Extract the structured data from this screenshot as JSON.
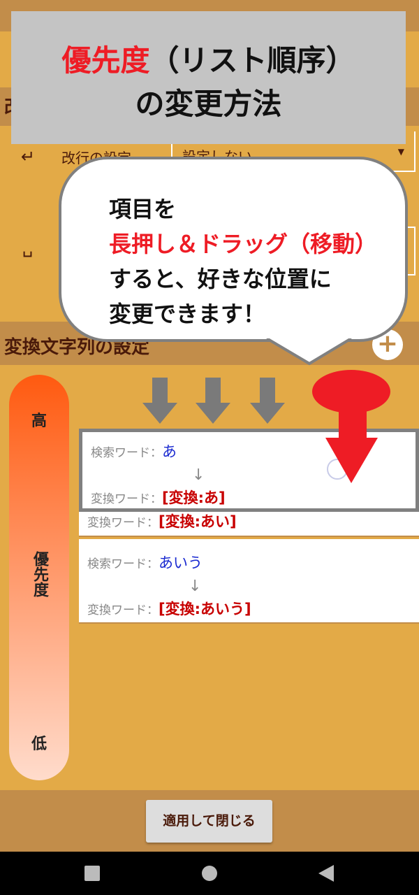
{
  "overlay_title": {
    "part1": "優先度",
    "part2": "（リスト順序）",
    "line2": "の変更方法"
  },
  "sections": {
    "partial_header": "改",
    "linebreak_label": "改行の設定",
    "linebreak_value": "設定しない",
    "space_icon": "␣",
    "return_icon": "↵",
    "conversion_header": "変換文字列の設定",
    "add_label": "+"
  },
  "priority": {
    "high": "高",
    "label": "優先度",
    "low": "低"
  },
  "cards": [
    {
      "search_label": "検索ワード：",
      "search": "あ",
      "arrow": "↓",
      "convert_label": "変換ワード：",
      "convert": "[変換:あ]"
    },
    {
      "convert_label": "変換ワード：",
      "convert": "[変換:あい]"
    },
    {
      "search_label": "検索ワード：",
      "search": "あいう",
      "arrow": "↓",
      "convert_label": "変換ワード：",
      "convert": "[変換:あいう]"
    }
  ],
  "callout": {
    "line1": "項目を",
    "line2": "長押し＆ドラッグ（移動）",
    "line3": "すると、好きな位置に",
    "line4": "変更できます！"
  },
  "apply_button": "適用して閉じる"
}
